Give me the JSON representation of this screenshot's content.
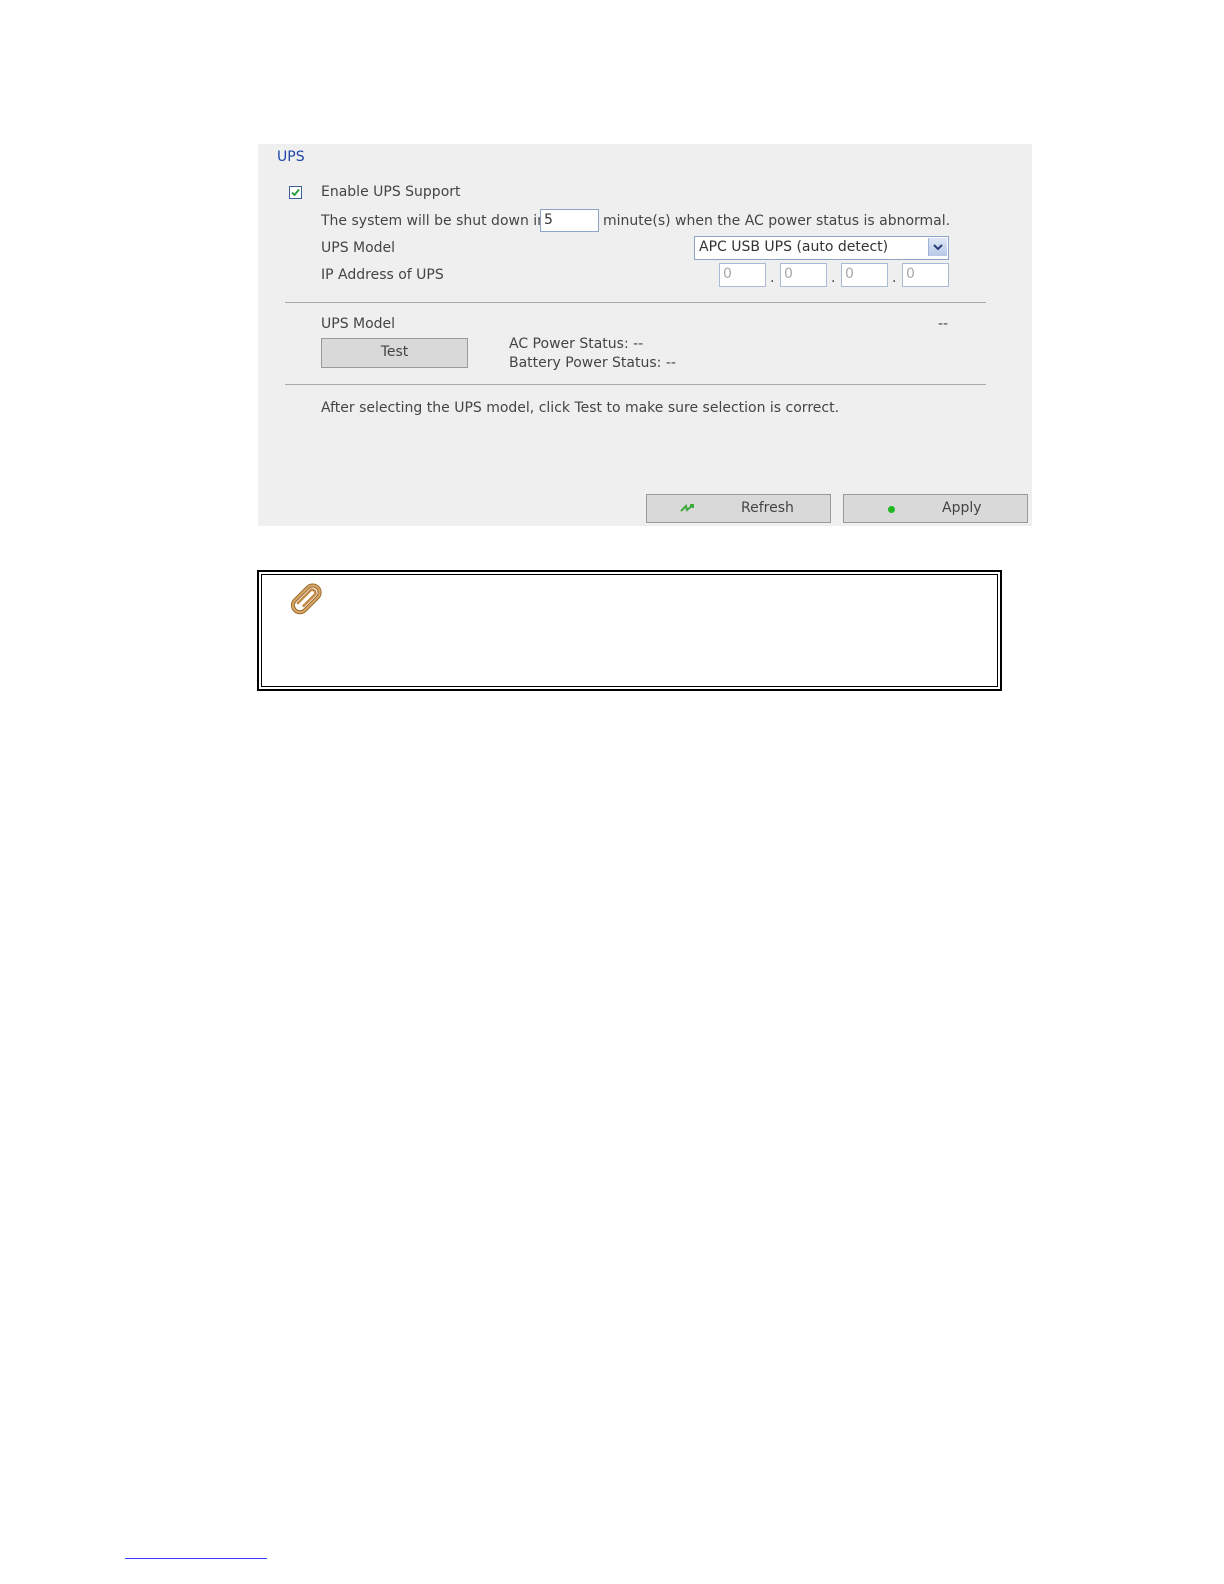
{
  "ups": {
    "section_title": "UPS",
    "enable_label": "Enable UPS Support",
    "enable_checked": true,
    "shutdown_prefix": "The system will be shut down in",
    "shutdown_minutes": "5",
    "shutdown_suffix": "minute(s) when the AC power status is abnormal.",
    "model_label": "UPS Model",
    "model_selected": "APC USB UPS (auto detect)",
    "ip_label": "IP Address of UPS",
    "ip_octets": [
      "0",
      "0",
      "0",
      "0"
    ],
    "ip_separator": "."
  },
  "status": {
    "model_label": "UPS Model",
    "model_value": "--",
    "test_button": "Test",
    "ac_power": "AC Power Status: --",
    "battery_power": "Battery Power Status: --"
  },
  "hint": "After selecting the UPS model, click Test to make sure selection is correct.",
  "actions": {
    "refresh_label": "Refresh",
    "apply_label": "Apply"
  },
  "icons": {
    "checkbox": "checkmark-icon",
    "dropdown": "chevron-down-icon",
    "refresh": "lightning-refresh-icon",
    "apply": "green-dot-icon",
    "note": "paperclip-icon"
  },
  "colors": {
    "panel_bg": "#efefef",
    "title_blue": "#1f45a8",
    "collapse_red": "#e02020",
    "apply_green": "#22b822"
  }
}
